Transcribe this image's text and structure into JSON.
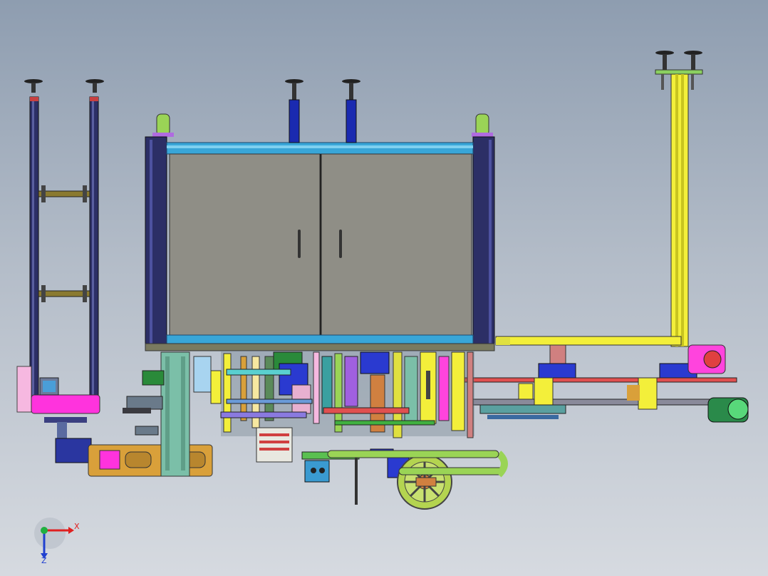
{
  "viewport": {
    "background_top": "#8e9db0",
    "background_bottom": "#d6dae0"
  },
  "triad": {
    "x_label": "X",
    "z_label": "Z",
    "x_color": "#e02020",
    "y_color": "#20b040",
    "z_color": "#2040d0"
  },
  "model": {
    "cabinet_panel_color": "#8f8e86",
    "frame_color": "#2c2f66",
    "rail_color": "#39a6d8",
    "pink_color": "#ff44dd",
    "yellow_color": "#f3ef3a",
    "green_color": "#9ad456",
    "teal_color": "#7bbfa8",
    "orange_color": "#d9a03a"
  }
}
